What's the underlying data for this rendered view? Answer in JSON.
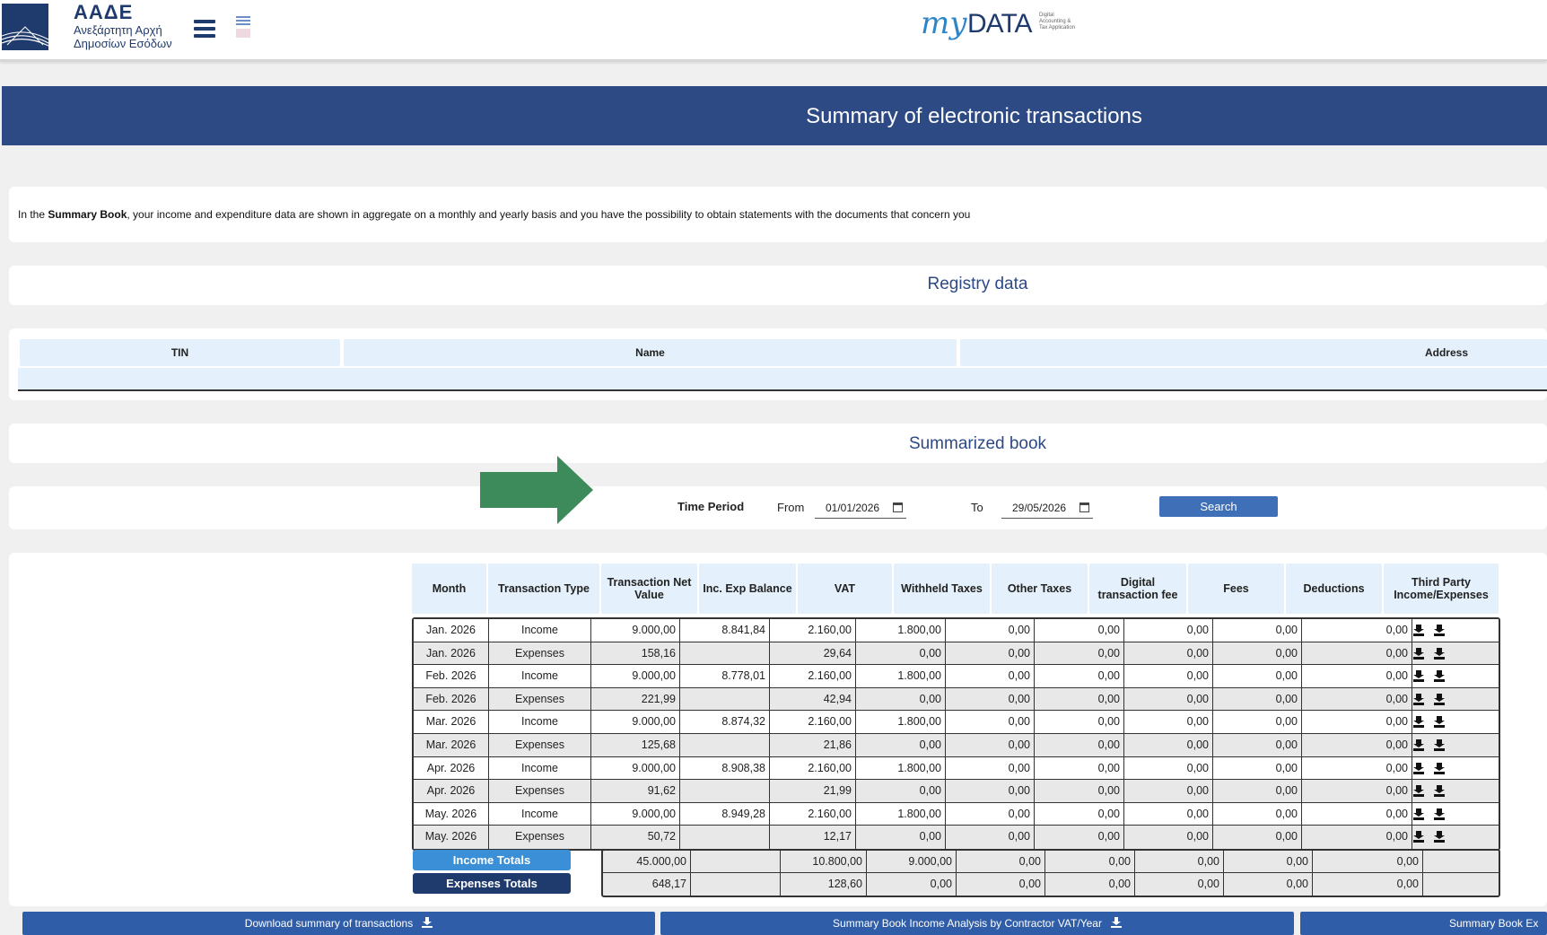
{
  "header": {
    "org_title": "ΑΑΔΕ",
    "org_sub1": "Ανεξάρτητη Αρχή",
    "org_sub2": "Δημοσίων Εσόδων",
    "brand_my": "my",
    "brand_data": "DATA",
    "brand_tagline": "Digital Accounting & Tax Application",
    "icons": {
      "menu": "hamburger-menu-icon",
      "lang_gr": "greek-flag-icon",
      "lang_en": "uk-flag-icon"
    }
  },
  "page_title": "Summary of electronic transactions",
  "intro": {
    "prefix": "In the ",
    "bold": "Summary Book",
    "suffix": ", your income and expenditure data are shown in aggregate on a monthly and yearly basis and you have the possibility to obtain statements with the documents that concern you"
  },
  "registry": {
    "title": "Registry data",
    "columns": [
      "TIN",
      "Name",
      "Address"
    ]
  },
  "summary": {
    "title": "Summarized book",
    "time_period_label": "Time Period",
    "from_label": "From",
    "from_value": "01/01/2026",
    "to_label": "To",
    "to_value": "29/05/2026",
    "search_label": "Search",
    "arrow_color": "#3d8a5a"
  },
  "table": {
    "columns": [
      "Month",
      "Transaction Type",
      "Transaction Net Value",
      "Inc. Exp Balance",
      "VAT",
      "Withheld Taxes",
      "Other Taxes",
      "Digital transaction fee",
      "Fees",
      "Deductions",
      "Third Party Income/Expenses"
    ],
    "rows": [
      [
        "Jan. 2026",
        "Income",
        "9.000,00",
        "8.841,84",
        "2.160,00",
        "1.800,00",
        "0,00",
        "0,00",
        "0,00",
        "0,00",
        "0,00"
      ],
      [
        "Jan. 2026",
        "Expenses",
        "158,16",
        "",
        "29,64",
        "0,00",
        "0,00",
        "0,00",
        "0,00",
        "0,00",
        "0,00"
      ],
      [
        "Feb. 2026",
        "Income",
        "9.000,00",
        "8.778,01",
        "2.160,00",
        "1.800,00",
        "0,00",
        "0,00",
        "0,00",
        "0,00",
        "0,00"
      ],
      [
        "Feb. 2026",
        "Expenses",
        "221,99",
        "",
        "42,94",
        "0,00",
        "0,00",
        "0,00",
        "0,00",
        "0,00",
        "0,00"
      ],
      [
        "Mar. 2026",
        "Income",
        "9.000,00",
        "8.874,32",
        "2.160,00",
        "1.800,00",
        "0,00",
        "0,00",
        "0,00",
        "0,00",
        "0,00"
      ],
      [
        "Mar. 2026",
        "Expenses",
        "125,68",
        "",
        "21,86",
        "0,00",
        "0,00",
        "0,00",
        "0,00",
        "0,00",
        "0,00"
      ],
      [
        "Apr. 2026",
        "Income",
        "9.000,00",
        "8.908,38",
        "2.160,00",
        "1.800,00",
        "0,00",
        "0,00",
        "0,00",
        "0,00",
        "0,00"
      ],
      [
        "Apr. 2026",
        "Expenses",
        "91,62",
        "",
        "21,99",
        "0,00",
        "0,00",
        "0,00",
        "0,00",
        "0,00",
        "0,00"
      ],
      [
        "May. 2026",
        "Income",
        "9.000,00",
        "8.949,28",
        "2.160,00",
        "1.800,00",
        "0,00",
        "0,00",
        "0,00",
        "0,00",
        "0,00"
      ],
      [
        "May. 2026",
        "Expenses",
        "50,72",
        "",
        "12,17",
        "0,00",
        "0,00",
        "0,00",
        "0,00",
        "0,00",
        "0,00"
      ]
    ],
    "totals": [
      {
        "label": "Income Totals",
        "color": "#3a8fd6",
        "values": [
          "45.000,00",
          "",
          "10.800,00",
          "9.000,00",
          "0,00",
          "0,00",
          "0,00",
          "0,00",
          "0,00"
        ]
      },
      {
        "label": "Expenses Totals",
        "color": "#1f3a6d",
        "values": [
          "648,17",
          "",
          "128,60",
          "0,00",
          "0,00",
          "0,00",
          "0,00",
          "0,00",
          "0,00"
        ]
      }
    ],
    "row_icon": "download-icon"
  },
  "bottom_buttons": [
    "Download summary of transactions",
    "Summary Book Income Analysis by Contractor VAT/Year",
    "Summary Book Ex"
  ],
  "colors": {
    "brand_blue": "#2d4a85",
    "header_cell": "#e4f0fb",
    "button_blue": "#2f5da8"
  }
}
